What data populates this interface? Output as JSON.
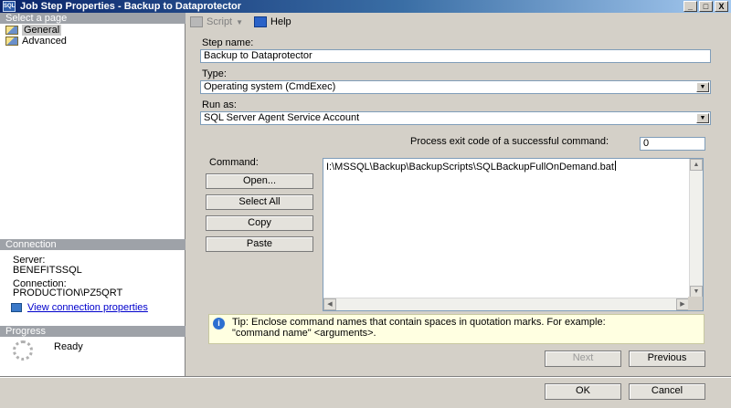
{
  "window": {
    "icon_text": "SQL",
    "title": "Job Step Properties - Backup to Dataprotector",
    "minimize": "_",
    "maximize": "□",
    "close": "X"
  },
  "left_pane": {
    "select_header": "Select a page",
    "pages": [
      {
        "label": "General",
        "selected": true
      },
      {
        "label": "Advanced",
        "selected": false
      }
    ],
    "connection_header": "Connection",
    "server_label": "Server:",
    "server_value": "BENEFITSSQL",
    "connection_label": "Connection:",
    "connection_value": "PRODUCTION\\PZ5QRT",
    "view_connection_link": "View connection properties",
    "progress_header": "Progress",
    "progress_status": "Ready"
  },
  "toolbar": {
    "script_label": "Script",
    "help_label": "Help"
  },
  "form": {
    "step_name_label": "Step name:",
    "step_name_value": "Backup to Dataprotector",
    "type_label": "Type:",
    "type_value": "Operating system (CmdExec)",
    "run_as_label": "Run as:",
    "run_as_value": "SQL Server Agent Service Account",
    "exit_code_label": "Process exit code of a successful command:",
    "exit_code_value": "0",
    "command_label": "Command:",
    "command_value": "I:\\MSSQL\\Backup\\BackupScripts\\SQLBackupFullOnDemand.bat",
    "buttons": {
      "open": "Open...",
      "select_all": "Select All",
      "copy": "Copy",
      "paste": "Paste"
    },
    "tip_line1": "Tip: Enclose command names that contain spaces in quotation marks. For example:",
    "tip_line2": "\"command name\" <arguments>."
  },
  "nav_buttons": {
    "next": "Next",
    "previous": "Previous"
  },
  "dialog_buttons": {
    "ok": "OK",
    "cancel": "Cancel"
  }
}
